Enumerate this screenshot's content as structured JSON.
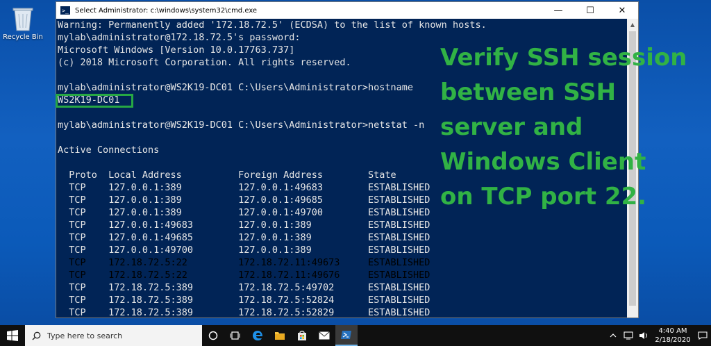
{
  "desktop": {
    "recycle_bin_label": "Recycle Bin"
  },
  "window": {
    "title": "Select Administrator: c:\\windows\\system32\\cmd.exe",
    "icon_glyph": ">_",
    "minimize_glyph": "—",
    "maximize_glyph": "☐",
    "close_glyph": "✕"
  },
  "console": {
    "lines": [
      "Warning: Permanently added '172.18.72.5' (ECDSA) to the list of known hosts.",
      "mylab\\administrator@172.18.72.5's password:",
      "Microsoft Windows [Version 10.0.17763.737]",
      "(c) 2018 Microsoft Corporation. All rights reserved.",
      "",
      "mylab\\administrator@WS2K19-DC01 C:\\Users\\Administrator>hostname",
      "WS2K19-DC01",
      "",
      "mylab\\administrator@WS2K19-DC01 C:\\Users\\Administrator>netstat -n",
      "",
      "Active Connections",
      "",
      "  Proto  Local Address          Foreign Address        State",
      "  TCP    127.0.0.1:389          127.0.0.1:49683        ESTABLISHED",
      "  TCP    127.0.0.1:389          127.0.0.1:49685        ESTABLISHED",
      "  TCP    127.0.0.1:389          127.0.0.1:49700        ESTABLISHED",
      "  TCP    127.0.0.1:49683        127.0.0.1:389          ESTABLISHED",
      "  TCP    127.0.0.1:49685        127.0.0.1:389          ESTABLISHED",
      "  TCP    127.0.0.1:49700        127.0.0.1:389          ESTABLISHED",
      "  TCP    172.18.72.5:22         172.18.72.11:49673     ESTABLISHED",
      "  TCP    172.18.72.5:22         172.18.72.11:49676     ESTABLISHED",
      "  TCP    172.18.72.5:389        172.18.72.5:49702      ESTABLISHED",
      "  TCP    172.18.72.5:389        172.18.72.5:52824      ESTABLISHED",
      "  TCP    172.18.72.5:389        172.18.72.5:52829      ESTABLISHED"
    ],
    "highlighted_line_color": "#000000",
    "text_color": "#e6e6e6",
    "background": "#012456"
  },
  "annotation": {
    "lines": [
      "Verify SSH session",
      "between SSH",
      "server and",
      "Windows Client",
      "on TCP port 22."
    ],
    "color": "#31b245",
    "highlight_border_color": "#27a844",
    "highlight_fill_color": "#fed8aa"
  },
  "taskbar": {
    "search_placeholder": "Type here to search",
    "time": "4:40 AM",
    "date": "2/18/2020",
    "icons": [
      "windows-start-icon",
      "search-icon",
      "task-view-icon",
      "task-manager-icon",
      "edge-icon",
      "file-explorer-icon",
      "store-icon",
      "mail-icon",
      "powershell-icon"
    ]
  }
}
